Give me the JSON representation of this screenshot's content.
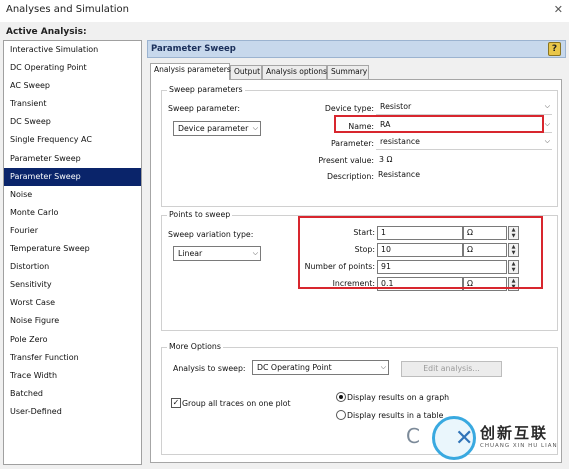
{
  "window": {
    "title": "Analyses and Simulation",
    "close_glyph": "✕"
  },
  "sidebar": {
    "header": "Active Analysis:",
    "selected_index": 7,
    "items": [
      "Interactive Simulation",
      "DC Operating Point",
      "AC Sweep",
      "Transient",
      "DC Sweep",
      "Single Frequency AC",
      "Parameter Sweep",
      "Parameter Sweep",
      "Noise",
      "Monte Carlo",
      "Fourier",
      "Temperature Sweep",
      "Distortion",
      "Sensitivity",
      "Worst Case",
      "Noise Figure",
      "Pole Zero",
      "Transfer Function",
      "Trace Width",
      "Batched",
      "User-Defined"
    ]
  },
  "main": {
    "title": "Parameter Sweep",
    "help": "?",
    "tabs": [
      "Analysis parameters",
      "Output",
      "Analysis options",
      "Summary"
    ],
    "sweep_parameters": {
      "group_title": "Sweep parameters",
      "sweep_parameter_label": "Sweep parameter:",
      "sweep_parameter_value": "Device parameter",
      "device_type_label": "Device type:",
      "device_type_value": "Resistor",
      "name_label": "Name:",
      "name_value": "RA",
      "parameter_label": "Parameter:",
      "parameter_value": "resistance",
      "present_value_label": "Present value:",
      "present_value_value": "3 Ω",
      "description_label": "Description:",
      "description_value": "Resistance"
    },
    "points_to_sweep": {
      "group_title": "Points to sweep",
      "variation_type_label": "Sweep variation type:",
      "variation_type_value": "Linear",
      "start_label": "Start:",
      "start_value": "1",
      "start_unit": "Ω",
      "stop_label": "Stop:",
      "stop_value": "10",
      "stop_unit": "Ω",
      "num_points_label": "Number of points:",
      "num_points_value": "91",
      "increment_label": "Increment:",
      "increment_value": "0.1",
      "increment_unit": "Ω"
    },
    "more_options": {
      "group_title": "More Options",
      "analysis_to_sweep_label": "Analysis to sweep:",
      "analysis_to_sweep_value": "DC Operating Point",
      "edit_analysis_label": "Edit analysis...",
      "group_traces_label": "Group all traces on one plot",
      "group_traces_checked": true,
      "display_graph_label": "Display results on a graph",
      "display_table_label": "Display results in a table",
      "display_mode": "graph"
    }
  },
  "watermark": {
    "cn": "创新互联",
    "en": "CHUANG XIN HU LIAN",
    "partial_letter": "C"
  },
  "colors": {
    "highlight_box": "#d8262e",
    "selection": "#0a246a",
    "header_bg": "#c7d8ec"
  }
}
